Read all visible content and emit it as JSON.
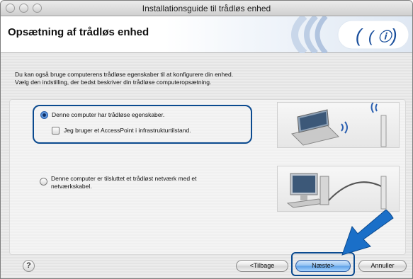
{
  "window": {
    "title": "Installationsguide til trådløs enhed"
  },
  "banner": {
    "title": "Opsætning af trådløs enhed"
  },
  "description": {
    "line1": "Du kan også bruge computerens trådløse egenskaber til at konfigurere din enhed.",
    "line2": "Vælg den indstilling, der bedst beskriver din trådløse computeropsætning."
  },
  "options": {
    "wireless": {
      "label": "Denne computer har trådløse egenskaber.",
      "selected": true
    },
    "accesspoint": {
      "label": "Jeg bruger et AccessPoint i infrastrukturtilstand.",
      "checked": false
    },
    "cable": {
      "line1": "Denne computer er tilsluttet et trådløst netværk med et",
      "line2": "netværkskabel.",
      "selected": false
    }
  },
  "buttons": {
    "help": "?",
    "back": "<Tilbage",
    "next": "Næste>",
    "cancel": "Annuller"
  },
  "colors": {
    "highlight": "#0b4a8f",
    "arrow": "#1a6fc8"
  }
}
